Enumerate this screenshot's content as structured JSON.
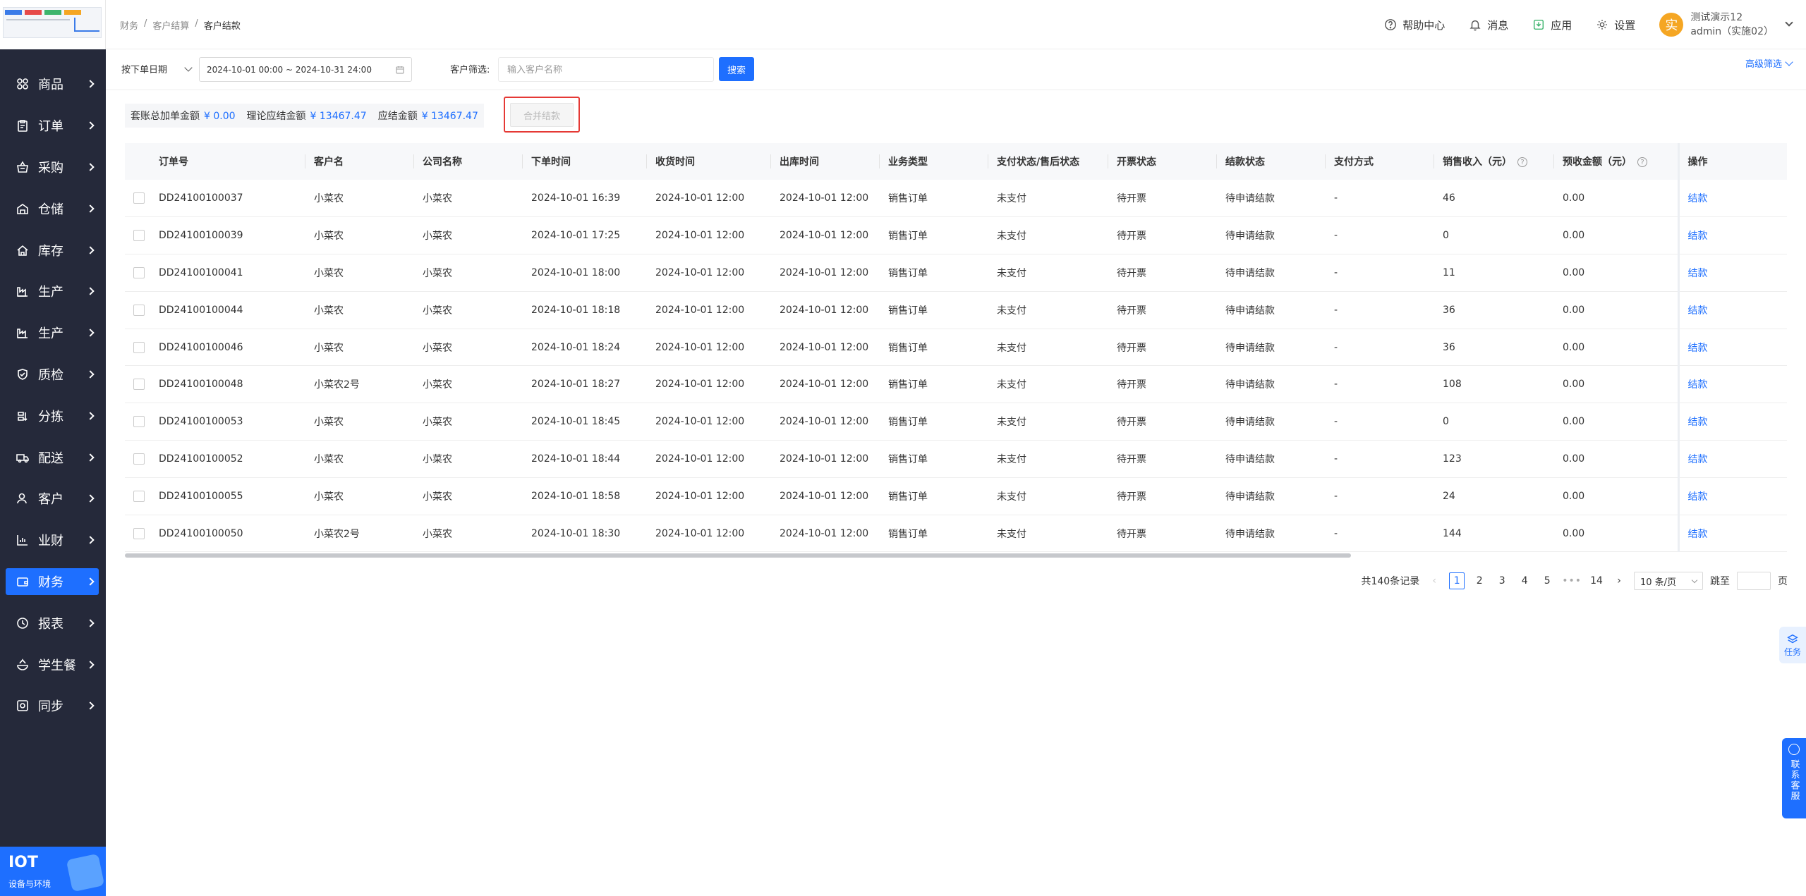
{
  "sidebar": {
    "items": [
      {
        "label": "商品",
        "icon": "grid-icon"
      },
      {
        "label": "订单",
        "icon": "clipboard-icon"
      },
      {
        "label": "采购",
        "icon": "basket-icon"
      },
      {
        "label": "仓储",
        "icon": "warehouse-icon"
      },
      {
        "label": "库存",
        "icon": "house-icon"
      },
      {
        "label": "生产",
        "icon": "factory-icon"
      },
      {
        "label": "生产",
        "icon": "factory-icon"
      },
      {
        "label": "质检",
        "icon": "shield-icon"
      },
      {
        "label": "分拣",
        "icon": "sort-icon"
      },
      {
        "label": "配送",
        "icon": "truck-icon"
      },
      {
        "label": "客户",
        "icon": "user-icon"
      },
      {
        "label": "业财",
        "icon": "chart-icon"
      },
      {
        "label": "财务",
        "icon": "wallet-icon"
      },
      {
        "label": "报表",
        "icon": "clock-icon"
      },
      {
        "label": "学生餐",
        "icon": "bowl-icon"
      },
      {
        "label": "同步",
        "icon": "sync-icon"
      }
    ],
    "active_index": 12,
    "iot_title": "IOT",
    "iot_subtitle": "设备与环境"
  },
  "breadcrumb": {
    "b1": "财务",
    "b2": "客户结算",
    "b3": "客户结款",
    "sep": "/"
  },
  "topbar": {
    "help": "帮助中心",
    "messages": "消息",
    "apps": "应用",
    "settings": "设置",
    "avatar_char": "实",
    "user_name": "测试演示12",
    "user_account": "admin（实施02）"
  },
  "filter": {
    "date_type": "按下单日期",
    "date_range": "2024-10-01 00:00 ~ 2024-10-31 24:00",
    "customer_label": "客户筛选:",
    "customer_placeholder": "输入客户名称",
    "customer_value": "",
    "search_btn": "搜索",
    "advanced": "高级筛选"
  },
  "summary": {
    "l1": "套账总加单金额",
    "v1": "¥ 0.00",
    "l2": "理论应结金额",
    "v2": "¥ 13467.47",
    "l3": "应结金额",
    "v3": "¥ 13467.47",
    "merge_btn": "合并结款"
  },
  "table": {
    "headers": {
      "order_no": "订单号",
      "customer": "客户名",
      "company": "公司名称",
      "order_time": "下单时间",
      "receive_time": "收货时间",
      "out_time": "出库时间",
      "biz_type": "业务类型",
      "pay_status": "支付状态/售后状态",
      "invoice_status": "开票状态",
      "settle_status": "结款状态",
      "pay_method": "支付方式",
      "sales_income": "销售收入（元）",
      "prepaid": "预收金额（元）",
      "action": "操作"
    },
    "rows": [
      {
        "order_no": "DD24100100037",
        "customer": "小菜农",
        "company": "小菜农",
        "order_time": "2024-10-01 16:39",
        "receive_time": "2024-10-01 12:00",
        "out_time": "2024-10-01 12:00",
        "biz_type": "销售订单",
        "pay_status": "未支付",
        "invoice_status": "待开票",
        "settle_status": "待申请结款",
        "pay_method": "-",
        "sales_income": "46",
        "prepaid": "0.00",
        "action": "结款"
      },
      {
        "order_no": "DD24100100039",
        "customer": "小菜农",
        "company": "小菜农",
        "order_time": "2024-10-01 17:25",
        "receive_time": "2024-10-01 12:00",
        "out_time": "2024-10-01 12:00",
        "biz_type": "销售订单",
        "pay_status": "未支付",
        "invoice_status": "待开票",
        "settle_status": "待申请结款",
        "pay_method": "-",
        "sales_income": "0",
        "prepaid": "0.00",
        "action": "结款"
      },
      {
        "order_no": "DD24100100041",
        "customer": "小菜农",
        "company": "小菜农",
        "order_time": "2024-10-01 18:00",
        "receive_time": "2024-10-01 12:00",
        "out_time": "2024-10-01 12:00",
        "biz_type": "销售订单",
        "pay_status": "未支付",
        "invoice_status": "待开票",
        "settle_status": "待申请结款",
        "pay_method": "-",
        "sales_income": "11",
        "prepaid": "0.00",
        "action": "结款"
      },
      {
        "order_no": "DD24100100044",
        "customer": "小菜农",
        "company": "小菜农",
        "order_time": "2024-10-01 18:18",
        "receive_time": "2024-10-01 12:00",
        "out_time": "2024-10-01 12:00",
        "biz_type": "销售订单",
        "pay_status": "未支付",
        "invoice_status": "待开票",
        "settle_status": "待申请结款",
        "pay_method": "-",
        "sales_income": "36",
        "prepaid": "0.00",
        "action": "结款"
      },
      {
        "order_no": "DD24100100046",
        "customer": "小菜农",
        "company": "小菜农",
        "order_time": "2024-10-01 18:24",
        "receive_time": "2024-10-01 12:00",
        "out_time": "2024-10-01 12:00",
        "biz_type": "销售订单",
        "pay_status": "未支付",
        "invoice_status": "待开票",
        "settle_status": "待申请结款",
        "pay_method": "-",
        "sales_income": "36",
        "prepaid": "0.00",
        "action": "结款"
      },
      {
        "order_no": "DD24100100048",
        "customer": "小菜农2号",
        "company": "小菜农",
        "order_time": "2024-10-01 18:27",
        "receive_time": "2024-10-01 12:00",
        "out_time": "2024-10-01 12:00",
        "biz_type": "销售订单",
        "pay_status": "未支付",
        "invoice_status": "待开票",
        "settle_status": "待申请结款",
        "pay_method": "-",
        "sales_income": "108",
        "prepaid": "0.00",
        "action": "结款"
      },
      {
        "order_no": "DD24100100053",
        "customer": "小菜农",
        "company": "小菜农",
        "order_time": "2024-10-01 18:45",
        "receive_time": "2024-10-01 12:00",
        "out_time": "2024-10-01 12:00",
        "biz_type": "销售订单",
        "pay_status": "未支付",
        "invoice_status": "待开票",
        "settle_status": "待申请结款",
        "pay_method": "-",
        "sales_income": "0",
        "prepaid": "0.00",
        "action": "结款"
      },
      {
        "order_no": "DD24100100052",
        "customer": "小菜农",
        "company": "小菜农",
        "order_time": "2024-10-01 18:44",
        "receive_time": "2024-10-01 12:00",
        "out_time": "2024-10-01 12:00",
        "biz_type": "销售订单",
        "pay_status": "未支付",
        "invoice_status": "待开票",
        "settle_status": "待申请结款",
        "pay_method": "-",
        "sales_income": "123",
        "prepaid": "0.00",
        "action": "结款"
      },
      {
        "order_no": "DD24100100055",
        "customer": "小菜农",
        "company": "小菜农",
        "order_time": "2024-10-01 18:58",
        "receive_time": "2024-10-01 12:00",
        "out_time": "2024-10-01 12:00",
        "biz_type": "销售订单",
        "pay_status": "未支付",
        "invoice_status": "待开票",
        "settle_status": "待申请结款",
        "pay_method": "-",
        "sales_income": "24",
        "prepaid": "0.00",
        "action": "结款"
      },
      {
        "order_no": "DD24100100050",
        "customer": "小菜农2号",
        "company": "小菜农",
        "order_time": "2024-10-01 18:30",
        "receive_time": "2024-10-01 12:00",
        "out_time": "2024-10-01 12:00",
        "biz_type": "销售订单",
        "pay_status": "未支付",
        "invoice_status": "待开票",
        "settle_status": "待申请结款",
        "pay_method": "-",
        "sales_income": "144",
        "prepaid": "0.00",
        "action": "结款"
      }
    ]
  },
  "pagination": {
    "total": "共140条记录",
    "pages": [
      "1",
      "2",
      "3",
      "4",
      "5"
    ],
    "current": "1",
    "dots": "•••",
    "last": "14",
    "page_size": "10 条/页",
    "jump_label": "跳至",
    "page_unit": "页"
  },
  "float": {
    "task": "任务",
    "service": "联系客服"
  },
  "colors": {
    "primary": "#1e6fff",
    "sidebar": "#25293a",
    "highlight": "#e53935"
  }
}
